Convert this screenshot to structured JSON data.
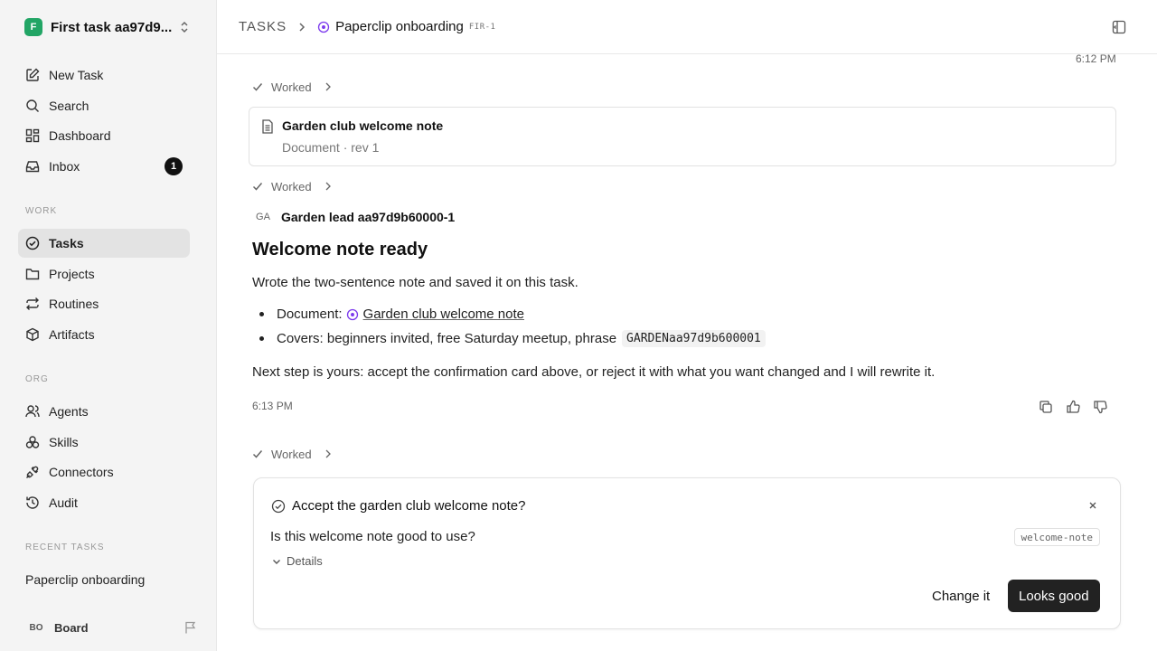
{
  "workspace": {
    "name": "First task aa97d9...",
    "logo_letter": "F",
    "logo_color": "#22a565"
  },
  "sidebar": {
    "top_items": [
      {
        "label": "New Task",
        "icon": "edit-icon"
      },
      {
        "label": "Search",
        "icon": "search-icon"
      },
      {
        "label": "Dashboard",
        "icon": "dashboard-icon"
      },
      {
        "label": "Inbox",
        "icon": "inbox-icon",
        "badge": "1"
      }
    ],
    "work_label": "WORK",
    "work_items": [
      {
        "label": "Tasks",
        "icon": "circle-check-icon",
        "active": true
      },
      {
        "label": "Projects",
        "icon": "folder-icon"
      },
      {
        "label": "Routines",
        "icon": "repeat-icon"
      },
      {
        "label": "Artifacts",
        "icon": "box-icon"
      }
    ],
    "org_label": "ORG",
    "org_items": [
      {
        "label": "Agents",
        "icon": "users-icon"
      },
      {
        "label": "Skills",
        "icon": "skills-icon"
      },
      {
        "label": "Connectors",
        "icon": "plug-icon"
      },
      {
        "label": "Audit",
        "icon": "history-icon"
      }
    ],
    "recent_label": "RECENT TASKS",
    "recent_items": [
      {
        "label": "Paperclip onboarding"
      }
    ],
    "board": {
      "initials": "BO",
      "name": "Board"
    }
  },
  "header": {
    "root": "TASKS",
    "title": "Paperclip onboarding",
    "task_id": "FIR-1"
  },
  "timeline": {
    "top_timestamp": "6:12 PM",
    "worked_label": "Worked",
    "document_card": {
      "title": "Garden club welcome note",
      "subtitle": "Document · rev 1"
    },
    "author": {
      "initials": "GA",
      "name": "Garden lead aa97d9b60000-1"
    },
    "message": {
      "heading": "Welcome note ready",
      "intro": "Wrote the two-sentence note and saved it on this task.",
      "bullet1_label": "Document:",
      "bullet1_link": "Garden club welcome note",
      "bullet2_text": "Covers: beginners invited, free Saturday meetup, phrase",
      "bullet2_code": "GARDENaa97d9b600001",
      "next_step": "Next step is yours: accept the confirmation card above, or reject it with what you want changed and I will rewrite it.",
      "timestamp": "6:13 PM"
    },
    "confirmation": {
      "title": "Accept the garden club welcome note?",
      "question": "Is this welcome note good to use?",
      "key": "welcome-note",
      "details_label": "Details",
      "reject_label": "Change it",
      "accept_label": "Looks good"
    }
  },
  "colors": {
    "accent": "#7c3aed",
    "sidebar_bg": "#f4f4f4",
    "active_bg": "#e3e3e3",
    "primary_button": "#222222"
  }
}
